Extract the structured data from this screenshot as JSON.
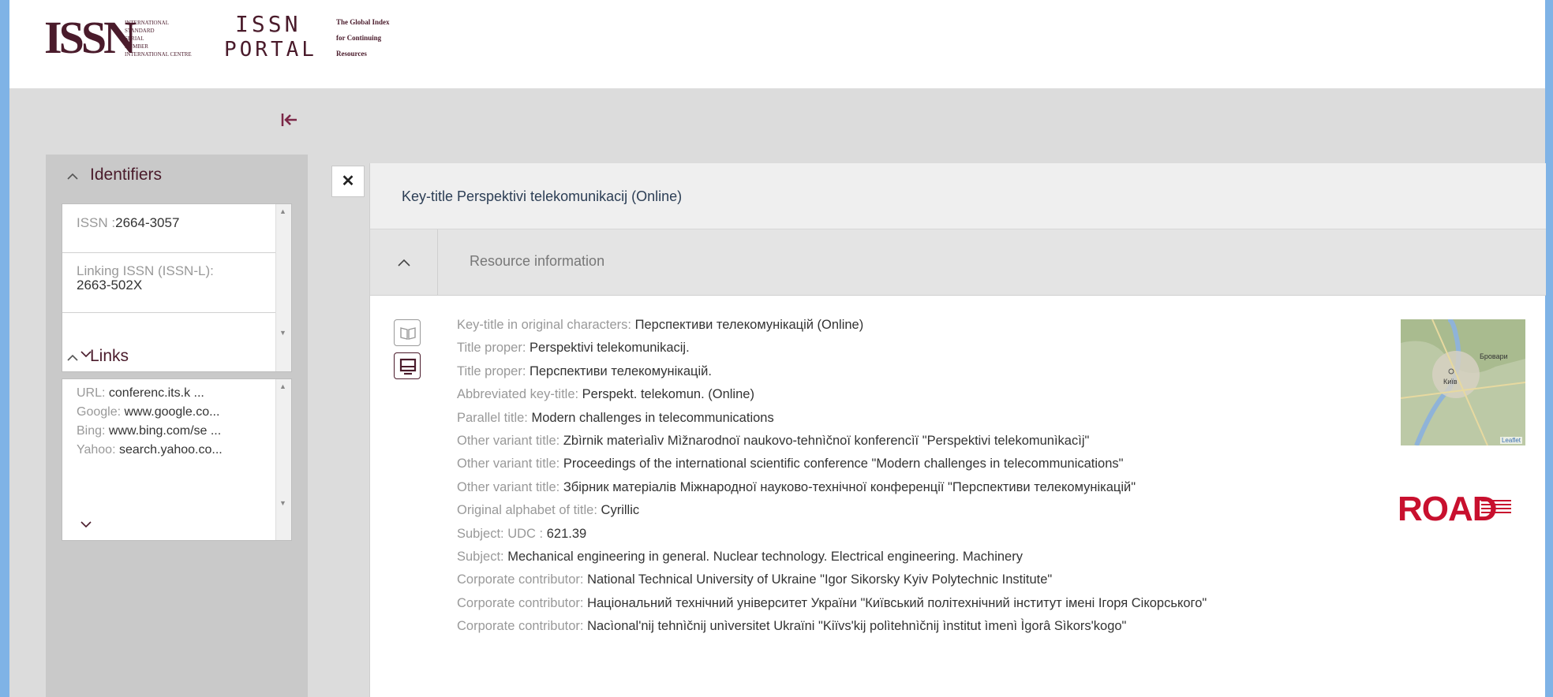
{
  "logos": {
    "issn_big": "ISSN",
    "issn_small": [
      "International",
      "Standard",
      "Serial",
      "Number",
      "International Centre"
    ],
    "portal_issn": "ISSN",
    "portal_word": "PORTAL",
    "portal_tagline": [
      "The Global Index",
      "for Continuing",
      "Resources"
    ]
  },
  "sidebar": {
    "identifiers": {
      "title": "Identifiers",
      "items": [
        {
          "label": "ISSN :",
          "value": "2664-3057"
        },
        {
          "label": "Linking ISSN (ISSN-L):",
          "value": "2663-502X"
        }
      ]
    },
    "links": {
      "title": "Links",
      "items": [
        {
          "label": "URL: ",
          "value": "conferenc.its.k ..."
        },
        {
          "label": "Google: ",
          "value": "www.google.co..."
        },
        {
          "label": "Bing: ",
          "value": "www.bing.com/se ..."
        },
        {
          "label": "Yahoo: ",
          "value": "search.yahoo.co..."
        }
      ]
    }
  },
  "main": {
    "title": "Key-title Perspektivi telekomunikacij (Online)",
    "section": "Resource information",
    "rows": [
      {
        "label": "Key-title in original characters: ",
        "value": "Перспективи телекомунікацій (Online)"
      },
      {
        "label": "Title proper: ",
        "value": "Perspektivi telekomunikacij."
      },
      {
        "label": "Title proper: ",
        "value": "Перспективи телекомунікацій."
      },
      {
        "label": "Abbreviated key-title: ",
        "value": "Perspekt. telekomun. (Online)"
      },
      {
        "label": "Parallel title: ",
        "value": "Modern challenges in telecommunications"
      },
      {
        "label": "Other variant title: ",
        "value": "Zbìrnik materìalìv Mìžnarodnoï naukovo-tehnìčnoï konferencìï \"Perspektivi telekomunìkacìj\""
      },
      {
        "label": "Other variant title: ",
        "value": "Proceedings of the international scientific conference \"Modern challenges in telecommunications\""
      },
      {
        "label": "Other variant title: ",
        "value": "Збірник матеріалів Міжнародної науково-технічної конференції \"Перспективи телекомунікацій\""
      },
      {
        "label": "Original alphabet of title: ",
        "value": "Cyrillic"
      },
      {
        "label": "Subject: UDC : ",
        "value": "621.39"
      },
      {
        "label": "Subject: ",
        "value": "Mechanical engineering in general. Nuclear technology. Electrical engineering. Machinery"
      },
      {
        "label": "Corporate contributor: ",
        "value": "National Technical University of Ukraine \"Igor Sikorsky Kyiv Polytechnic Institute\""
      },
      {
        "label": "Corporate contributor: ",
        "value": "Національний технічний університет України \"Київський політехнічний інститут імені Ігоря Сікорського\""
      },
      {
        "label": "Corporate contributor: ",
        "value": "Nacìonal'nij tehnìčnij unìversitet Ukraïni \"Kiïvs'kij polìtehnìčnij ìnstitut ìmenì Ìgorâ Sìkors'kogo\""
      }
    ],
    "map_labels": {
      "city1": "Бровари",
      "city2": "Київ",
      "credit": "Leaflet"
    },
    "road_logo": "ROAD"
  },
  "colors": {
    "brand": "#4a1b2b",
    "accent": "#7b2747",
    "road": "#c8102e"
  },
  "icons": [
    "collapse-sidebar-icon",
    "close-icon",
    "chevron-up-icon",
    "chevron-down-icon",
    "book-icon",
    "monitor-icon"
  ]
}
